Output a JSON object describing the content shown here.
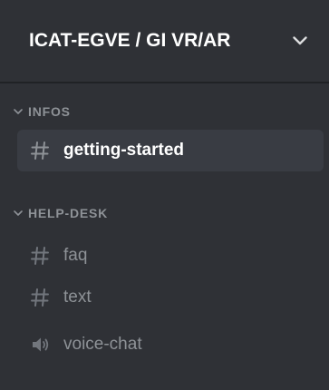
{
  "server": {
    "name": "ICAT-EGVE / GI VR/AR"
  },
  "categories": [
    {
      "name": "INFOS",
      "channels": [
        {
          "name": "getting-started",
          "type": "text",
          "icon": "hash-icon",
          "selected": true
        }
      ]
    },
    {
      "name": "HELP-DESK",
      "channels": [
        {
          "name": "faq",
          "type": "text",
          "icon": "hash-icon",
          "selected": false
        },
        {
          "name": "text",
          "type": "text",
          "icon": "hash-icon",
          "selected": false
        },
        {
          "name": "voice-chat",
          "type": "voice",
          "icon": "speaker-icon",
          "selected": false
        }
      ]
    }
  ],
  "colors": {
    "background": "#2f3136",
    "header_border": "#202225",
    "selected_bg": "#393c43",
    "muted_text": "#8e9297",
    "active_text": "#ffffff"
  }
}
